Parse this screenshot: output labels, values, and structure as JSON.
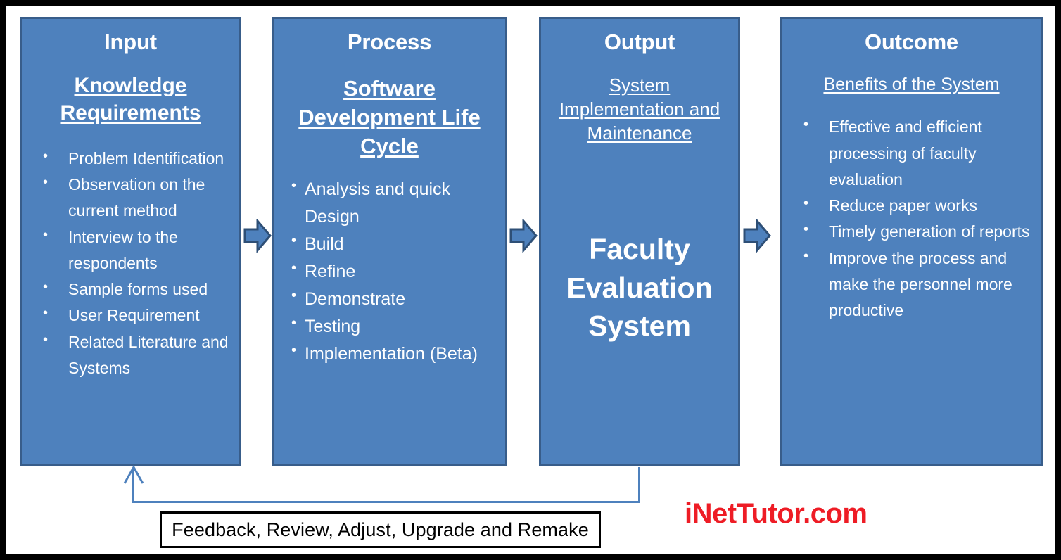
{
  "diagram": {
    "type": "ipo-conceptual-framework",
    "colors": {
      "box_fill": "#4E81BD",
      "box_border": "#385D8A",
      "arrow_fill": "#4E81BD",
      "arrow_border": "#2E4F76",
      "text": "#FFFFFF",
      "feedback_border": "#000000",
      "feedback_line": "#4E81BD",
      "branding": "#EE1C25",
      "frame": "#000000"
    },
    "stages": [
      {
        "id": "input",
        "title": "Input",
        "subtitle": "Knowledge Requirements",
        "subtitle_underlined": true,
        "items": [
          "Problem Identification",
          "Observation on the current method",
          "Interview to the respondents",
          "Sample forms used",
          "User Requirement",
          "Related Literature and Systems"
        ]
      },
      {
        "id": "process",
        "title": "Process",
        "subtitle": "Software Development Life Cycle",
        "subtitle_underlined": true,
        "items": [
          "Analysis and quick Design",
          "Build",
          "Refine",
          "Demonstrate",
          "Testing",
          "Implementation (Beta)"
        ]
      },
      {
        "id": "output",
        "title": "Output",
        "subtitle": "System Implementation and Maintenance",
        "subtitle_underlined": true,
        "headline": "Faculty Evaluation System",
        "items": []
      },
      {
        "id": "outcome",
        "title": "Outcome",
        "subtitle": "Benefits of the System",
        "subtitle_underlined": true,
        "items": [
          "Effective and efficient processing of faculty evaluation",
          "Reduce paper works",
          "Timely generation of reports",
          "Improve the process and make the personnel more productive"
        ]
      }
    ],
    "connectors": [
      {
        "id": "input-to-process",
        "icon": "right-block-arrow-icon"
      },
      {
        "id": "process-to-output",
        "icon": "right-block-arrow-icon"
      },
      {
        "id": "output-to-outcome",
        "icon": "right-block-arrow-icon"
      }
    ],
    "feedback": {
      "label": "Feedback, Review, Adjust, Upgrade and Remake",
      "from": "output",
      "to": "input",
      "arrowhead": "up-arrowhead-icon"
    },
    "branding": {
      "text": "iNetTutor.com"
    }
  }
}
